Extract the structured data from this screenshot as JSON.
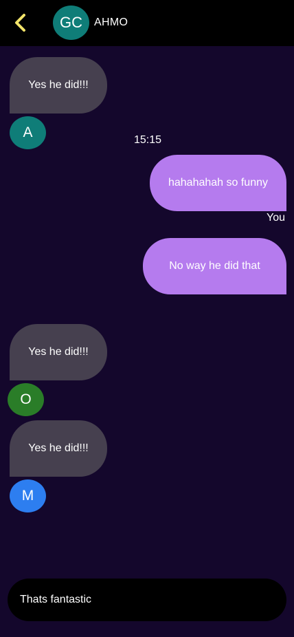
{
  "header": {
    "back_icon": "chevron-left-icon",
    "back_color": "#f3e46a",
    "avatar_initials": "GC",
    "avatar_color": "#0f7d78",
    "title": "AHMO"
  },
  "messages": [
    {
      "direction": "in",
      "text": "Yes he did!!!",
      "avatar": "A",
      "avatar_color": "#0f7d78"
    },
    {
      "direction": "out",
      "text": "hahahahah so funny",
      "timestamp": "15:15",
      "sender": "You"
    },
    {
      "direction": "out",
      "text": "No way he did that"
    },
    {
      "direction": "in",
      "text": "Yes he did!!!",
      "avatar": "O",
      "avatar_color": "#2a7d28"
    },
    {
      "direction": "in",
      "text": "Yes he did!!!",
      "avatar": "M",
      "avatar_color": "#2d7ef0"
    }
  ],
  "colors": {
    "background": "#14072c",
    "incoming_bubble": "#46404f",
    "outgoing_bubble": "#b57bee"
  },
  "composer": {
    "value": "Thats fantastic",
    "placeholder": ""
  }
}
